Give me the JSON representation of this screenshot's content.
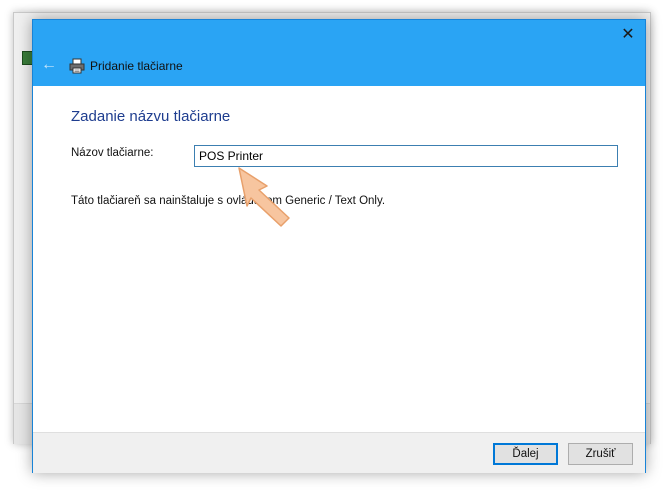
{
  "dialog": {
    "title": "Pridanie tlačiarne",
    "back_icon": "back-arrow-icon",
    "close_icon": "close-icon",
    "printer_icon": "printer-icon",
    "titlebar_color": "#2aa4f4"
  },
  "content": {
    "heading": "Zadanie názvu tlačiarne",
    "name_label": "Názov tlačiarne:",
    "name_value": "POS Printer",
    "install_note": "Táto tlačiareň sa nainštaluje s ovládačom Generic / Text Only."
  },
  "footer": {
    "next_label": "Ďalej",
    "cancel_label": "Zrušiť"
  },
  "annotation": {
    "pointer_icon": "pointer-arrow-icon",
    "pointer_color": "#f7c59f"
  }
}
